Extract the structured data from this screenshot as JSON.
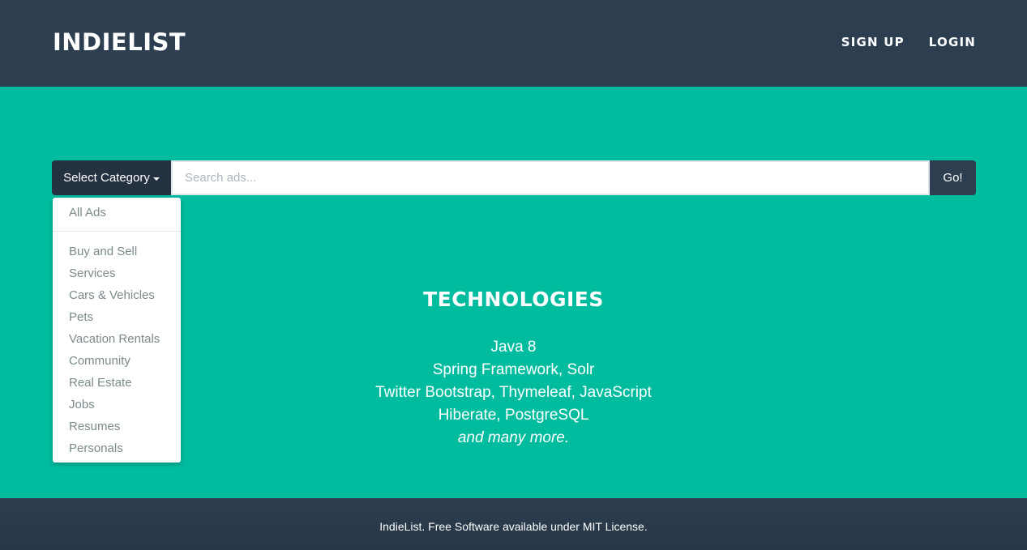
{
  "navbar": {
    "brand": "INDIELIST",
    "links": [
      "SIGN UP",
      "LOGIN"
    ]
  },
  "search": {
    "category_label": "Select Category",
    "placeholder": "Search ads...",
    "go_label": "Go!"
  },
  "dropdown": {
    "first_item": "All Ads",
    "items": [
      "Buy and Sell",
      "Services",
      "Cars & Vehicles",
      "Pets",
      "Vacation Rentals",
      "Community",
      "Real Estate",
      "Jobs",
      "Resumes",
      "Personals"
    ]
  },
  "technologies": {
    "title": "TECHNOLOGIES",
    "lines": [
      "Java 8",
      "Spring Framework, Solr",
      "Twitter Bootstrap, Thymeleaf, JavaScript",
      "Hiberate, PostgreSQL"
    ],
    "closing": "and many more."
  },
  "footer": {
    "text": "IndieList. Free Software available under MIT License."
  },
  "colors": {
    "navbar": "#2c3e50",
    "hero": "#00bc9f",
    "category_button": "#233140",
    "dropdown_text": "#7b8a8b"
  },
  "icons": {
    "category_caret": "caret-down-icon"
  }
}
